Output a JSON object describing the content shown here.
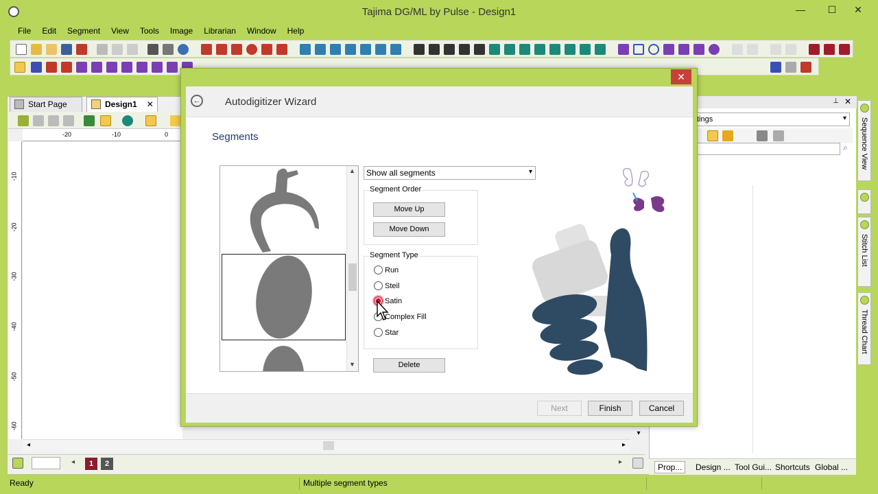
{
  "window": {
    "title": "Tajima DG/ML by Pulse - Design1",
    "minimize": "—",
    "maximize": "☐",
    "close": "✕"
  },
  "menu": [
    "File",
    "Edit",
    "Segment",
    "View",
    "Tools",
    "Image",
    "Librarian",
    "Window",
    "Help"
  ],
  "tabs": {
    "start_page": "Start Page",
    "design1": "Design1",
    "close": "✕"
  },
  "ruler": {
    "h_ticks": [
      "-20",
      "-10",
      "0"
    ],
    "v_ticks": [
      "-10",
      "-20",
      "-30",
      "-40",
      "-50",
      "-60"
    ]
  },
  "pages": {
    "page1": "1",
    "page2": "2"
  },
  "right_panel": {
    "select_value": "tings",
    "tabs": [
      "Prop...",
      "Design ...",
      "Tool Gui...",
      "Shortcuts",
      "Global ..."
    ],
    "side_tabs": [
      "Sequence View",
      "Stitch List",
      "Thread Chart"
    ]
  },
  "status": {
    "ready": "Ready",
    "message": "Multiple segment types"
  },
  "dialog": {
    "title": "Autodigitizer Wizard",
    "close": "✕",
    "back": "←",
    "section": "Segments",
    "dropdown_value": "Show all segments",
    "segment_order_label": "Segment Order",
    "move_up": "Move Up",
    "move_down": "Move Down",
    "segment_type_label": "Segment Type",
    "segment_types": [
      "Run",
      "Steil",
      "Satin",
      "Complex Fill",
      "Star"
    ],
    "selected_type": "Satin",
    "delete": "Delete",
    "next": "Next",
    "finish": "Finish",
    "cancel": "Cancel"
  },
  "colors": {
    "chrome_green": "#b8d65a",
    "segment_gray": "#7a7a7a",
    "illustration_navy": "#2f4a63",
    "page1_red": "#8c1c2e",
    "page2_gray": "#555555",
    "radio_red": "#c8102e"
  }
}
